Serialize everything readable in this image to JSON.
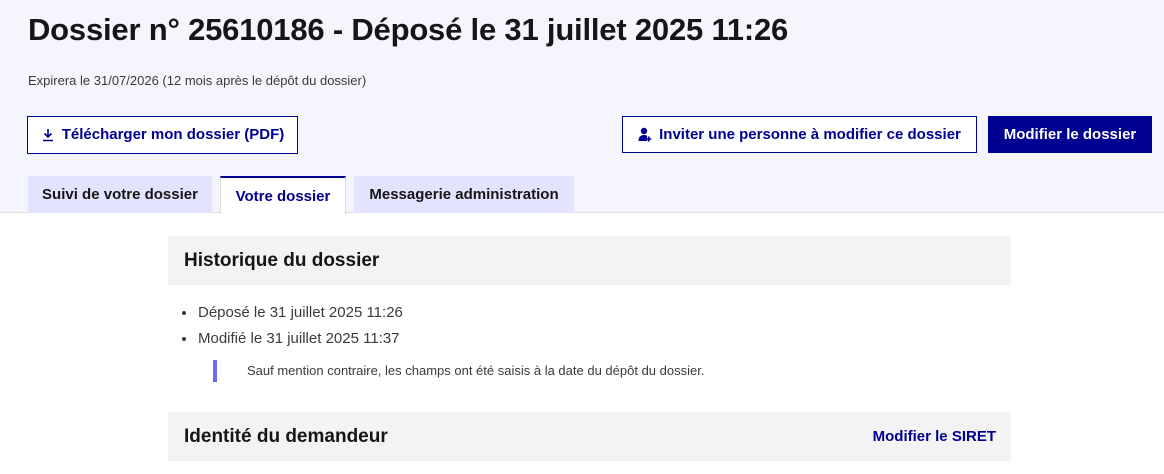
{
  "dossier": {
    "title": "Dossier n° 25610186 - Déposé le 31 juillet 2025 11:26",
    "expiry": "Expirera le 31/07/2026 (12 mois après le dépôt du dossier)"
  },
  "actions": {
    "download_label": "Télécharger mon dossier (PDF)",
    "invite_label": "Inviter une personne à modifier ce dossier",
    "modify_label": "Modifier le dossier"
  },
  "tabs": [
    {
      "label": "Suivi de votre dossier",
      "active": false
    },
    {
      "label": "Votre dossier",
      "active": true
    },
    {
      "label": "Messagerie administration",
      "active": false
    }
  ],
  "history": {
    "title": "Historique du dossier",
    "items": [
      "Déposé le 31 juillet 2025 11:26",
      "Modifié le 31 juillet 2025 11:37"
    ],
    "note": "Sauf mention contraire, les champs ont été saisis à la date du dépôt du dossier."
  },
  "identity": {
    "title": "Identité du demandeur",
    "modify_siret_label": "Modifier le SIRET"
  },
  "colors": {
    "accent": "#000091",
    "header_background": "#f5f5fe",
    "tab_background": "#e3e3fd",
    "callout_bar": "#6a6af4"
  },
  "icons": {
    "download": "download-icon",
    "invite": "user-add-icon"
  }
}
